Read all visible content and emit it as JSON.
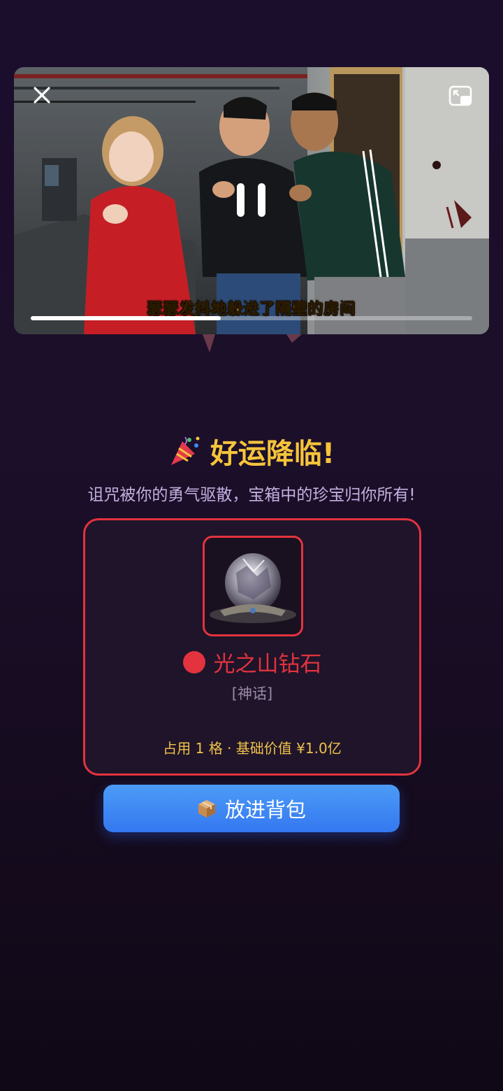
{
  "video": {
    "subtitle": "瑟瑟发抖地躲进了隔壁的房间",
    "progress": 0.43,
    "controls": {
      "close_icon": "close-icon",
      "pause_icon": "pause-icon",
      "pip_icon": "picture-in-picture-icon"
    }
  },
  "reward": {
    "emoji_icon": "party-popper-icon",
    "title": "好运降临!",
    "description": "诅咒被你的勇气驱散，宝箱中的珍宝归你所有!",
    "item": {
      "image_icon": "diamond-crown-icon",
      "name": "光之山钻石",
      "rarity": "[神话]",
      "rarity_color": "#e2333f",
      "meta": "占用 1 格 · 基础价值 ¥1.0亿"
    },
    "button": {
      "label": "放进背包",
      "icon": "package-box-icon"
    }
  },
  "colors": {
    "accent_gold": "#f5c43a",
    "mythic_red": "#e2333f",
    "button_blue": "#3b82f6",
    "background": "#1b0e2c"
  }
}
